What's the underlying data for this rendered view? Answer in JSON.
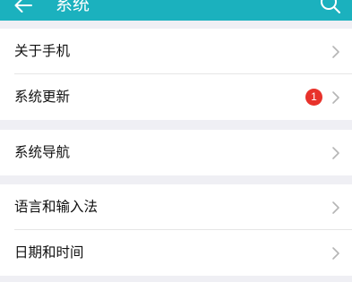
{
  "header": {
    "title": "系统"
  },
  "groups": [
    {
      "items": [
        {
          "label": "关于手机"
        },
        {
          "label": "系统更新",
          "badge": "1"
        }
      ]
    },
    {
      "items": [
        {
          "label": "系统导航"
        }
      ]
    },
    {
      "items": [
        {
          "label": "语言和输入法"
        },
        {
          "label": "日期和时间"
        }
      ]
    }
  ],
  "colors": {
    "app_bar": "#1bb1be",
    "badge": "#e8322b",
    "background": "#efeff4"
  },
  "icons": {
    "back": "arrow-left-icon",
    "search": "search-icon",
    "chevron": "chevron-right-icon"
  }
}
